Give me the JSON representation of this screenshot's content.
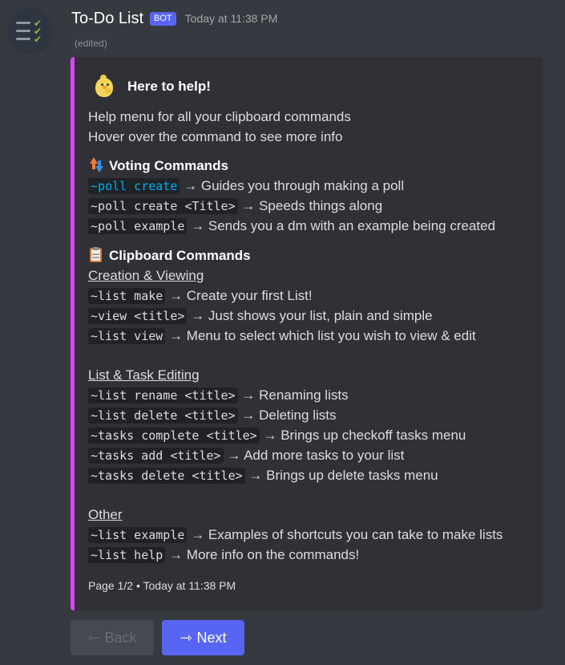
{
  "message": {
    "username": "To-Do List",
    "bot_tag": "BOT",
    "timestamp": "Today at 11:38 PM",
    "edited": "(edited)"
  },
  "embed": {
    "accent_color": "#e040fb",
    "author_name": "Here to help!",
    "intro": [
      "Help menu for all your clipboard commands",
      "Hover over the command to see more info"
    ],
    "voting": {
      "title": "Voting Commands",
      "items": [
        {
          "code": "~poll create",
          "desc": "Guides you through making a poll"
        },
        {
          "code": "~poll create <Title>",
          "desc": "Speeds things along"
        },
        {
          "code": "~poll example",
          "desc": "Sends you a dm with an example being created"
        }
      ]
    },
    "clipboard": {
      "title": "Clipboard Commands",
      "sections": [
        {
          "heading": "Creation & Viewing",
          "items": [
            {
              "code": "~list make",
              "desc": "Create your first List!"
            },
            {
              "code": "~view <title>",
              "desc": "Just shows your list, plain and simple"
            },
            {
              "code": "~list view",
              "desc": "Menu to select which list you wish to view & edit"
            }
          ]
        },
        {
          "heading": "List & Task Editing",
          "items": [
            {
              "code": "~list rename <title>",
              "desc": "Renaming lists"
            },
            {
              "code": "~list delete <title>",
              "desc": "Deleting lists"
            },
            {
              "code": "~tasks complete <title>",
              "desc": "Brings up checkoff tasks menu"
            },
            {
              "code": "~tasks add <title>",
              "desc": "Add more tasks to your list"
            },
            {
              "code": "~tasks delete <title>",
              "desc": "Brings up delete tasks menu"
            }
          ]
        },
        {
          "heading": "Other",
          "items": [
            {
              "code": "~list example",
              "desc": "Examples of shortcuts you can take to make lists"
            },
            {
              "code": "~list help",
              "desc": "More info on the commands!"
            }
          ]
        }
      ]
    },
    "arrow": "→",
    "footer_page": "Page 1/2",
    "footer_sep": "•",
    "footer_time": "Today at 11:38 PM"
  },
  "buttons": {
    "back_icon": "⇽",
    "back_label": "Back",
    "next_icon": "⇾",
    "next_label": "Next"
  },
  "icons": {
    "avatar": "checklist-icon",
    "author": "chick-icon",
    "voting": "up-down-arrows-icon",
    "clipboard": "clipboard-icon"
  },
  "colors": {
    "background": "#36393f",
    "embed_bg": "#2f3136",
    "bot_tag": "#5865f2",
    "next_button": "#5865f2",
    "link_code": "#00aff4"
  }
}
